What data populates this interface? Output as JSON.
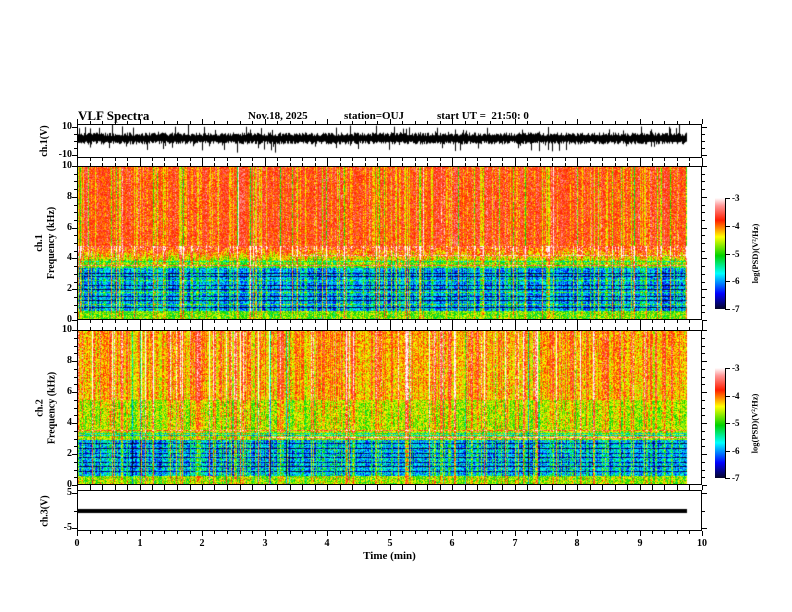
{
  "header": {
    "title": "VLF Spectra",
    "date": "Nov.18, 2025",
    "station": "station=OUJ",
    "start_ut": "start UT =  21:50: 0"
  },
  "x_axis": {
    "label": "Time (min)",
    "range": [
      0,
      10
    ],
    "minor_step": 0.2,
    "ticks": [
      {
        "v": 0,
        "t": "0"
      },
      {
        "v": 1,
        "t": "1"
      },
      {
        "v": 2,
        "t": "2"
      },
      {
        "v": 3,
        "t": "3"
      },
      {
        "v": 4,
        "t": "4"
      },
      {
        "v": 5,
        "t": "5"
      },
      {
        "v": 6,
        "t": "6"
      },
      {
        "v": 7,
        "t": "7"
      },
      {
        "v": 8,
        "t": "8"
      },
      {
        "v": 9,
        "t": "9"
      },
      {
        "v": 10,
        "t": "10"
      }
    ]
  },
  "panels": {
    "wave1": {
      "ylabel": "ch.1(V)",
      "ylim": [
        -12,
        12
      ],
      "yticks": [
        {
          "v": 10,
          "t": "10"
        },
        {
          "v": -10,
          "t": "-10"
        }
      ],
      "yminor": [
        5,
        0,
        -5
      ]
    },
    "spec1": {
      "ylabel_l1": "ch.1",
      "ylabel_l2": "Frequency (kHz)",
      "ylim": [
        0,
        10
      ],
      "yticks": [
        {
          "v": 0,
          "t": "0"
        },
        {
          "v": 2,
          "t": "2"
        },
        {
          "v": 4,
          "t": "4"
        },
        {
          "v": 6,
          "t": "6"
        },
        {
          "v": 8,
          "t": "8"
        },
        {
          "v": 10,
          "t": "10"
        }
      ],
      "yminor_step": 0.5
    },
    "spec2": {
      "ylabel_l1": "ch.2",
      "ylabel_l2": "Frequency (kHz)",
      "ylim": [
        0,
        10
      ],
      "yticks": [
        {
          "v": 0,
          "t": "0"
        },
        {
          "v": 2,
          "t": "2"
        },
        {
          "v": 4,
          "t": "4"
        },
        {
          "v": 6,
          "t": "6"
        },
        {
          "v": 8,
          "t": "8"
        },
        {
          "v": 10,
          "t": "10"
        }
      ],
      "yminor_step": 0.5
    },
    "wave3": {
      "ylabel": "ch.3(V)",
      "ylim": [
        -6,
        6
      ],
      "yticks": [
        {
          "v": 5,
          "t": "5"
        },
        {
          "v": -5,
          "t": "-5"
        }
      ],
      "yminor": [
        0
      ]
    }
  },
  "colorbars": [
    {
      "label": "log(PSD)(V²/Hz)",
      "range": [
        -3,
        -7
      ],
      "ticks": [
        {
          "v": -3,
          "t": "-3"
        },
        {
          "v": -4,
          "t": "-4"
        },
        {
          "v": -5,
          "t": "-5"
        },
        {
          "v": -6,
          "t": "-6"
        },
        {
          "v": -7,
          "t": "-7"
        }
      ]
    },
    {
      "label": "log(PSD)(V²/Hz)",
      "range": [
        -3,
        -7
      ],
      "ticks": [
        {
          "v": -3,
          "t": "-3"
        },
        {
          "v": -4,
          "t": "-4"
        },
        {
          "v": -5,
          "t": "-5"
        },
        {
          "v": -6,
          "t": "-6"
        },
        {
          "v": -7,
          "t": "-7"
        }
      ]
    }
  ],
  "colormap": [
    {
      "t": 0.0,
      "rgb": [
        5,
        5,
        40
      ]
    },
    {
      "t": 0.14,
      "rgb": [
        0,
        0,
        255
      ]
    },
    {
      "t": 0.32,
      "rgb": [
        0,
        255,
        255
      ]
    },
    {
      "t": 0.48,
      "rgb": [
        0,
        210,
        0
      ]
    },
    {
      "t": 0.65,
      "rgb": [
        255,
        255,
        0
      ]
    },
    {
      "t": 0.8,
      "rgb": [
        255,
        30,
        0
      ]
    },
    {
      "t": 0.93,
      "rgb": [
        255,
        150,
        150
      ]
    },
    {
      "t": 1.0,
      "rgb": [
        255,
        255,
        255
      ]
    }
  ],
  "chart_data": [
    {
      "type": "line",
      "panel": "ch.1 time series",
      "xlabel": "Time (min)",
      "ylabel": "ch.1(V)",
      "xlim": [
        0,
        10
      ],
      "ylim": [
        -10,
        10
      ],
      "description": "Dense black audio-band waveform, mean level near +2 V, typical envelope about ±3 V with frequent spikes reaching ±10 V; recorded data ends near 9.8 min.",
      "render": {
        "seed": 11,
        "center_frac": 0.42,
        "spike_prob": 0.09,
        "data_frac": 0.978
      }
    },
    {
      "type": "heatmap",
      "panel": "ch.1 spectrogram",
      "xlabel": "Time (min)",
      "ylabel": "ch.1 Frequency (kHz)",
      "zlabel": "log(PSD)(V²/Hz)",
      "xlim": [
        0,
        10
      ],
      "ylim": [
        0,
        10
      ],
      "zlim": [
        -7,
        -3
      ],
      "bands": [
        {
          "f_khz": [
            0,
            0.5
          ],
          "level": -5.0,
          "level_to": -5.0,
          "noise": 0.5,
          "streak": 0.7
        },
        {
          "f_khz": [
            0.5,
            3.3
          ],
          "level": -6.3,
          "level_to": -6.3,
          "noise": 0.45,
          "streak": 1.7
        },
        {
          "f_khz": [
            3.3,
            4.8
          ],
          "level": -5.4,
          "level_to": -3.9,
          "noise": 0.5,
          "streak": 1.1
        },
        {
          "f_khz": [
            4.8,
            10
          ],
          "level": -3.6,
          "level_to": -3.6,
          "noise": 0.35,
          "streak": -0.85
        }
      ],
      "hlines": [
        {
          "khz": 0.7,
          "dv": -1.2
        },
        {
          "khz": 0.95,
          "dv": 0.9
        },
        {
          "khz": 1.2,
          "dv": -1.3
        },
        {
          "khz": 1.45,
          "dv": -1.0
        },
        {
          "khz": 1.7,
          "dv": 0.8
        },
        {
          "khz": 1.95,
          "dv": -1.2
        },
        {
          "khz": 2.2,
          "dv": -0.9
        },
        {
          "khz": 2.5,
          "dv": 0.7
        },
        {
          "khz": 2.75,
          "dv": -1.1
        },
        {
          "khz": 3.0,
          "dv": -1.0
        },
        {
          "khz": 3.3,
          "dv": -0.8
        },
        {
          "khz": 3.5,
          "dv": 1.2
        },
        {
          "khz": 3.8,
          "dv": -0.7
        },
        {
          "khz": 4.2,
          "dv": 0.9,
          "x0": 0.35
        }
      ],
      "render": {
        "seed": 7,
        "strong_prob": 0.1,
        "colline_prob": 0.012,
        "colline_dv": 0.55,
        "data_frac": 0.978
      }
    },
    {
      "type": "heatmap",
      "panel": "ch.2 spectrogram",
      "xlabel": "Time (min)",
      "ylabel": "ch.2 Frequency (kHz)",
      "zlabel": "log(PSD)(V²/Hz)",
      "xlim": [
        0,
        10
      ],
      "ylim": [
        0,
        10
      ],
      "zlim": [
        -7,
        -3
      ],
      "bands": [
        {
          "f_khz": [
            0,
            0.5
          ],
          "level": -4.9,
          "level_to": -4.9,
          "noise": 0.5,
          "streak": 0.8
        },
        {
          "f_khz": [
            0.5,
            2.8
          ],
          "level": -6.2,
          "level_to": -6.2,
          "noise": 0.5,
          "streak": 1.6
        },
        {
          "f_khz": [
            2.8,
            5.5
          ],
          "level": -4.9,
          "level_to": -4.8,
          "noise": 0.45,
          "streak": 1.0
        },
        {
          "f_khz": [
            5.5,
            10
          ],
          "level": -4.5,
          "level_to": -4.4,
          "noise": 0.4,
          "streak": 1.1
        }
      ],
      "hlines": [
        {
          "khz": 0.8,
          "dv": -1.0
        },
        {
          "khz": 1.1,
          "dv": -1.2
        },
        {
          "khz": 1.4,
          "dv": -0.9
        },
        {
          "khz": 1.7,
          "dv": -1.1
        },
        {
          "khz": 2.0,
          "dv": -0.8
        },
        {
          "khz": 2.3,
          "dv": -1.2
        },
        {
          "khz": 2.6,
          "dv": -1.0
        },
        {
          "khz": 2.85,
          "dv": -1.3
        },
        {
          "khz": 3.0,
          "dv": 1.3,
          "x0": 0.3
        },
        {
          "khz": 3.15,
          "dv": -1.1
        },
        {
          "khz": 3.3,
          "dv": -0.9
        },
        {
          "khz": 3.5,
          "dv": 0.8
        }
      ],
      "render": {
        "seed": 23,
        "strong_prob": 0.16,
        "colline_prob": 0.02,
        "colline_dv": -0.7,
        "data_frac": 0.978
      }
    },
    {
      "type": "line",
      "panel": "ch.3 time series",
      "xlabel": "Time (min)",
      "ylabel": "ch.3(V)",
      "xlim": [
        0,
        10
      ],
      "ylim": [
        -5,
        5
      ],
      "description": "Constant 0 V thick flat trace from 0 to about 9.8 min (no signal on channel 3).",
      "render": {
        "value": 0,
        "thickness": 4,
        "data_frac": 0.978
      }
    }
  ]
}
